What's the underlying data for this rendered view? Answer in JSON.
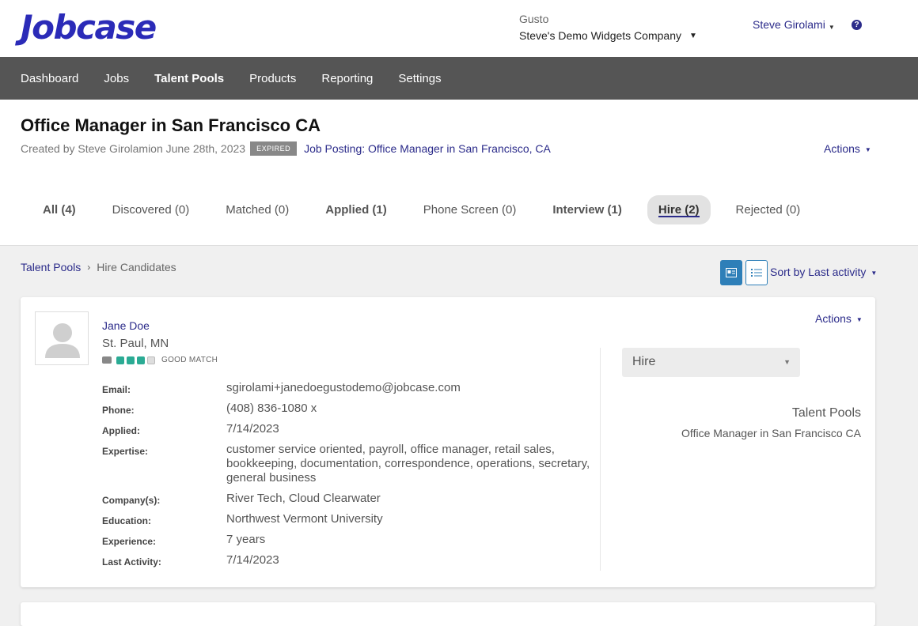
{
  "brand": {
    "logo_text": "Jobcase"
  },
  "company": {
    "org": "Gusto",
    "name": "Steve's Demo Widgets Company"
  },
  "user": {
    "name": "Steve Girolami"
  },
  "nav": {
    "items": [
      {
        "label": "Dashboard"
      },
      {
        "label": "Jobs"
      },
      {
        "label": "Talent Pools"
      },
      {
        "label": "Products"
      },
      {
        "label": "Reporting"
      },
      {
        "label": "Settings"
      }
    ],
    "active": "Talent Pools"
  },
  "header": {
    "title": "Office Manager in San Francisco CA",
    "created_by": "Created by Steve Girolamion June 28th, 2023",
    "badge": "EXPIRED",
    "job_link": "Job Posting: Office Manager in San Francisco, CA",
    "actions_label": "Actions"
  },
  "tabs": [
    {
      "label": "All (4)"
    },
    {
      "label": "Discovered (0)"
    },
    {
      "label": "Matched (0)"
    },
    {
      "label": "Applied (1)"
    },
    {
      "label": "Phone Screen (0)"
    },
    {
      "label": "Interview (1)"
    },
    {
      "label": "Hire (2)"
    },
    {
      "label": "Rejected (0)"
    }
  ],
  "breadcrumb": {
    "parent": "Talent Pools",
    "current": "Hire Candidates"
  },
  "sort": {
    "label": "Sort by Last activity"
  },
  "candidate": {
    "name": "Jane Doe",
    "location": "St. Paul, MN",
    "match_level": 3,
    "match_max": 4,
    "match_label": "GOOD MATCH",
    "fields": {
      "email_label": "Email:",
      "email": "sgirolami+janedoegustodemo@jobcase.com",
      "phone_label": "Phone:",
      "phone": "(408) 836-1080 x",
      "applied_label": "Applied:",
      "applied": "7/14/2023",
      "expertise_label": "Expertise:",
      "expertise": "customer service oriented, payroll, office manager, retail sales, bookkeeping, documentation, correspondence, operations, secretary, general business",
      "companies_label": "Company(s):",
      "companies": "River Tech, Cloud Clearwater",
      "education_label": "Education:",
      "education": "Northwest Vermont University",
      "experience_label": "Experience:",
      "experience": "7 years",
      "last_activity_label": "Last Activity:",
      "last_activity": "7/14/2023"
    },
    "actions_label": "Actions",
    "status": "Hire",
    "pools_title": "Talent Pools",
    "pools_item": "Office Manager in San Francisco CA"
  },
  "colors": {
    "brand": "#2b2bb8",
    "link": "#2b2b8a",
    "nav_bg": "#555555",
    "match": "#2bab94",
    "view_active": "#2e7fb8"
  }
}
